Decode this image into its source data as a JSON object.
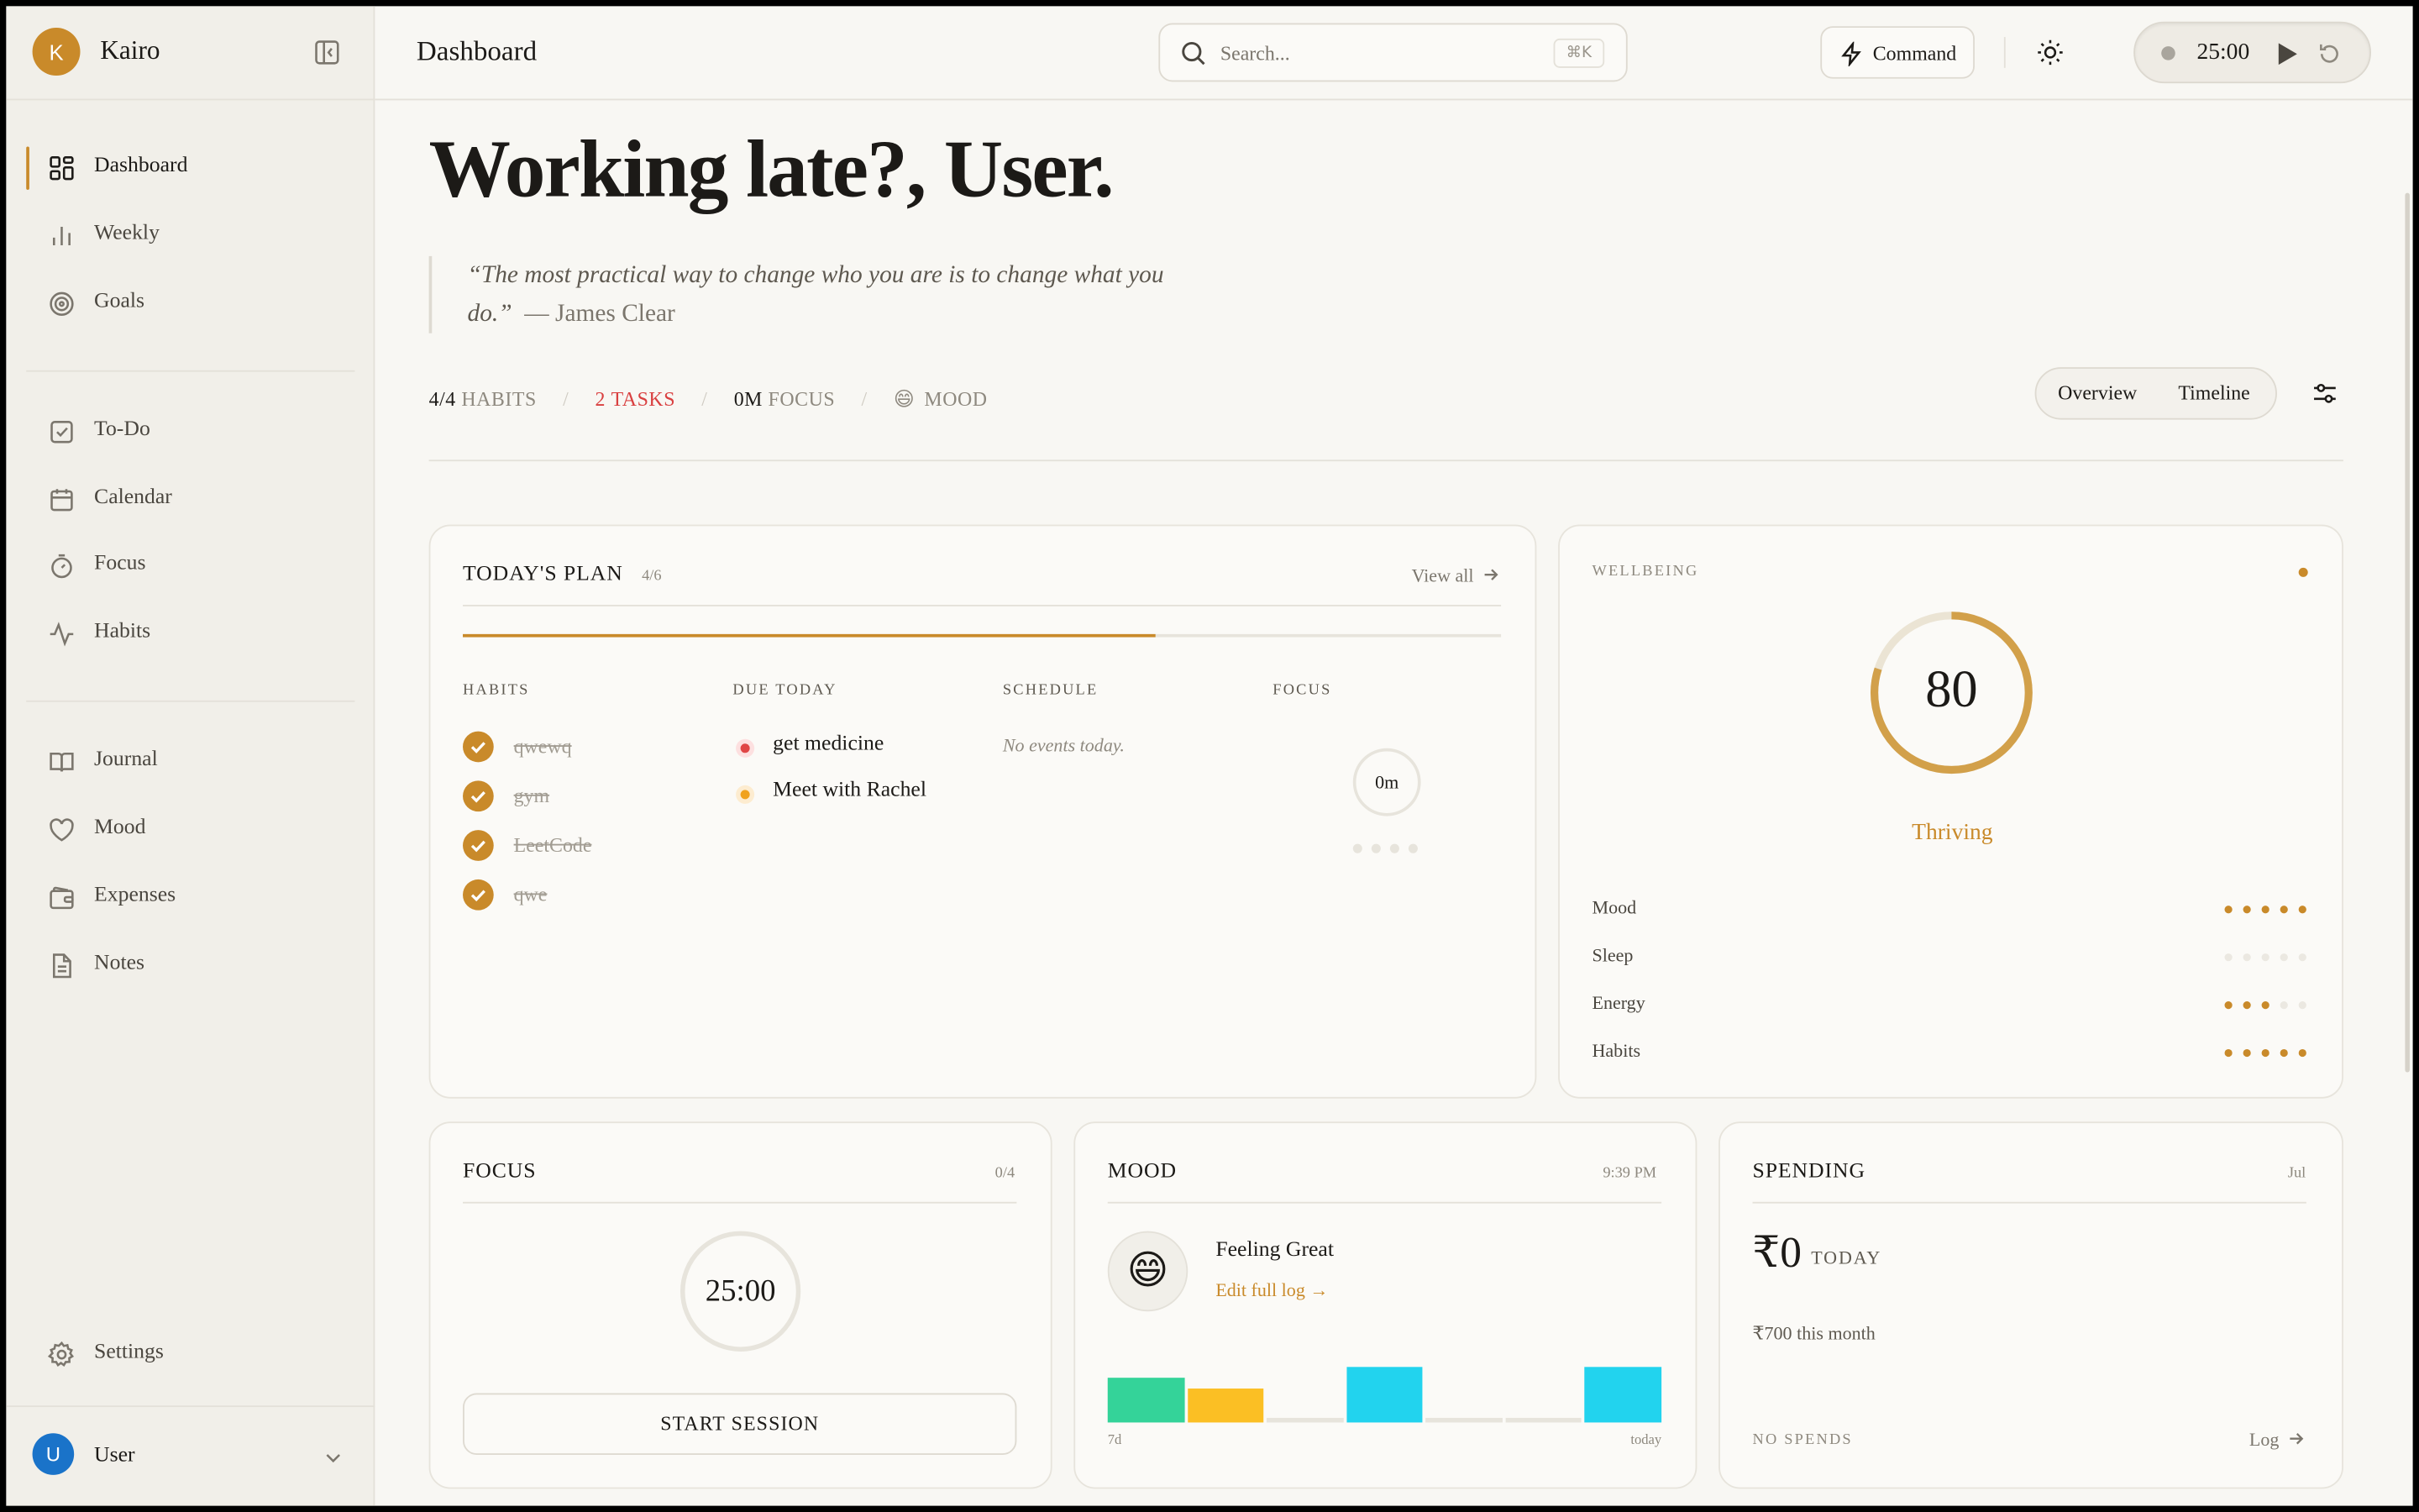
{
  "app": {
    "name": "Kairo",
    "brand_initial": "K"
  },
  "sidebar": {
    "items": [
      {
        "label": "Dashboard",
        "icon": "grid-icon",
        "active": true
      },
      {
        "label": "Weekly",
        "icon": "bar-chart-icon"
      },
      {
        "label": "Goals",
        "icon": "target-icon"
      },
      {
        "label": "To-Do",
        "icon": "checkbox-icon"
      },
      {
        "label": "Calendar",
        "icon": "calendar-icon"
      },
      {
        "label": "Focus",
        "icon": "stopwatch-icon"
      },
      {
        "label": "Habits",
        "icon": "activity-icon"
      },
      {
        "label": "Journal",
        "icon": "book-icon"
      },
      {
        "label": "Mood",
        "icon": "heart-icon"
      },
      {
        "label": "Expenses",
        "icon": "wallet-icon"
      },
      {
        "label": "Notes",
        "icon": "file-text-icon"
      }
    ],
    "settings_label": "Settings",
    "user": {
      "initial": "U",
      "name": "User"
    }
  },
  "header": {
    "title": "Dashboard",
    "search_placeholder": "Search...",
    "search_shortcut": "⌘K",
    "command_label": "Command",
    "timer": "25:00"
  },
  "main": {
    "greeting": "Working late?, User.",
    "quote": "“The most practical way to change who you are is to change what you do.”",
    "quote_author": "— James Clear",
    "stats": {
      "habits_value": "4/4",
      "habits_label": "HABITS",
      "tasks_value": "2",
      "tasks_label": "TASKS",
      "focus_value": "0M",
      "focus_label": "FOCUS",
      "mood_emoji": "😄",
      "mood_label": "MOOD"
    },
    "view_toggle": {
      "options": [
        "Overview",
        "Timeline"
      ],
      "selected": "Overview"
    }
  },
  "plan": {
    "title": "TODAY'S PLAN",
    "count": "4/6",
    "progress": 0.667,
    "view_all": "View all",
    "habits_header": "HABITS",
    "habits": [
      "qwewq",
      "gym",
      "LeetCode",
      "qwe"
    ],
    "due_header": "DUE TODAY",
    "due": [
      {
        "label": "get medicine",
        "color": "#e04646"
      },
      {
        "label": "Meet with Rachel",
        "color": "#f0a21e"
      }
    ],
    "schedule_header": "SCHEDULE",
    "schedule_empty": "No events today.",
    "focus_header": "FOCUS",
    "focus_value": "0m"
  },
  "wellbeing": {
    "title": "WELLBEING",
    "score": "80",
    "score_fraction": 0.8,
    "status": "Thriving",
    "metrics": [
      {
        "label": "Mood",
        "filled": 5
      },
      {
        "label": "Sleep",
        "filled": 0
      },
      {
        "label": "Energy",
        "filled": 3
      },
      {
        "label": "Habits",
        "filled": 5
      }
    ]
  },
  "focus_card": {
    "title": "FOCUS",
    "count": "0/4",
    "time": "25:00",
    "start_label": "START SESSION"
  },
  "mood_card": {
    "title": "MOOD",
    "time": "9:39 PM",
    "emoji": "😄",
    "feeling": "Feeling Great",
    "edit_link": "Edit full log →",
    "start_label": "7d",
    "end_label": "today",
    "bars": [
      {
        "level": 0.8,
        "color": "#34d399"
      },
      {
        "level": 0.6,
        "color": "#fbbf24"
      },
      {
        "level": 0,
        "color": "#e7e4dc"
      },
      {
        "level": 1.0,
        "color": "#22d3ee"
      },
      {
        "level": 0,
        "color": "#e7e4dc"
      },
      {
        "level": 0,
        "color": "#e7e4dc"
      },
      {
        "level": 1.0,
        "color": "#22d3ee"
      }
    ]
  },
  "spending": {
    "title": "SPENDING",
    "month": "Jul",
    "today_amount": "₹0",
    "today_label": "TODAY",
    "month_total": "₹700 this month",
    "status": "NO SPENDS",
    "log_label": "Log"
  },
  "colors": {
    "accent": "#c98a2a",
    "danger": "#d94040",
    "bg": "#f8f7f3",
    "sidebar": "#f1efe9"
  }
}
